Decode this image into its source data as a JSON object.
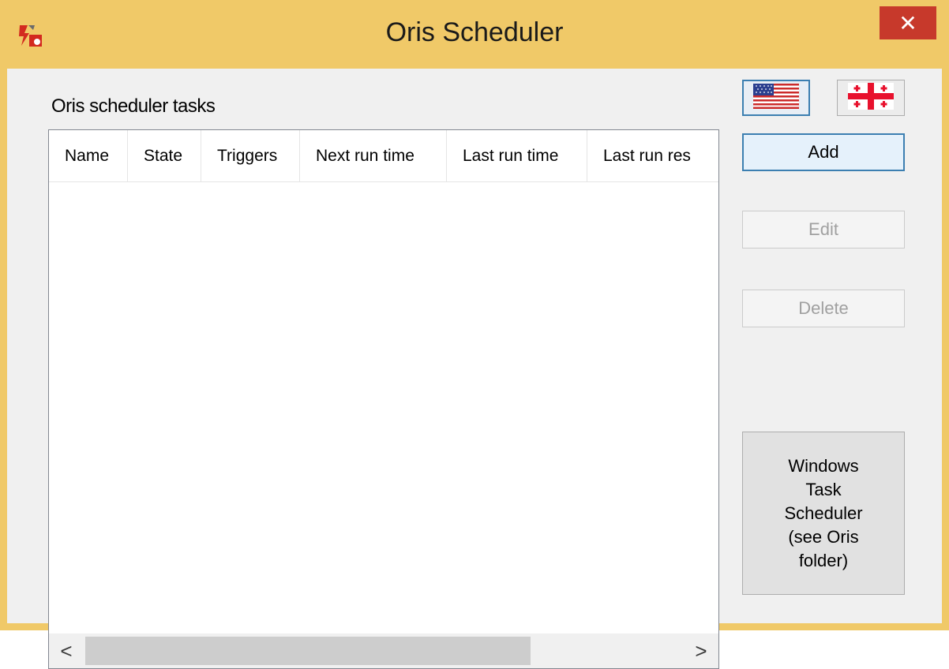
{
  "window": {
    "title": "Oris Scheduler",
    "close_label": "✕",
    "accent": "#f0c968",
    "close_color": "#c7392b"
  },
  "tasks": {
    "label": "Oris scheduler tasks",
    "columns": [
      "Name",
      "State",
      "Triggers",
      "Next run time",
      "Last run time",
      "Last run res"
    ],
    "rows": []
  },
  "scrollbar": {
    "left_arrow": "<",
    "right_arrow": ">"
  },
  "language": {
    "english_icon": "us-flag-icon",
    "georgian_icon": "georgia-flag-icon"
  },
  "buttons": {
    "add": "Add",
    "edit": "Edit",
    "delete": "Delete",
    "windows_scheduler": "Windows\nTask\nScheduler\n(see Oris\nfolder)"
  }
}
